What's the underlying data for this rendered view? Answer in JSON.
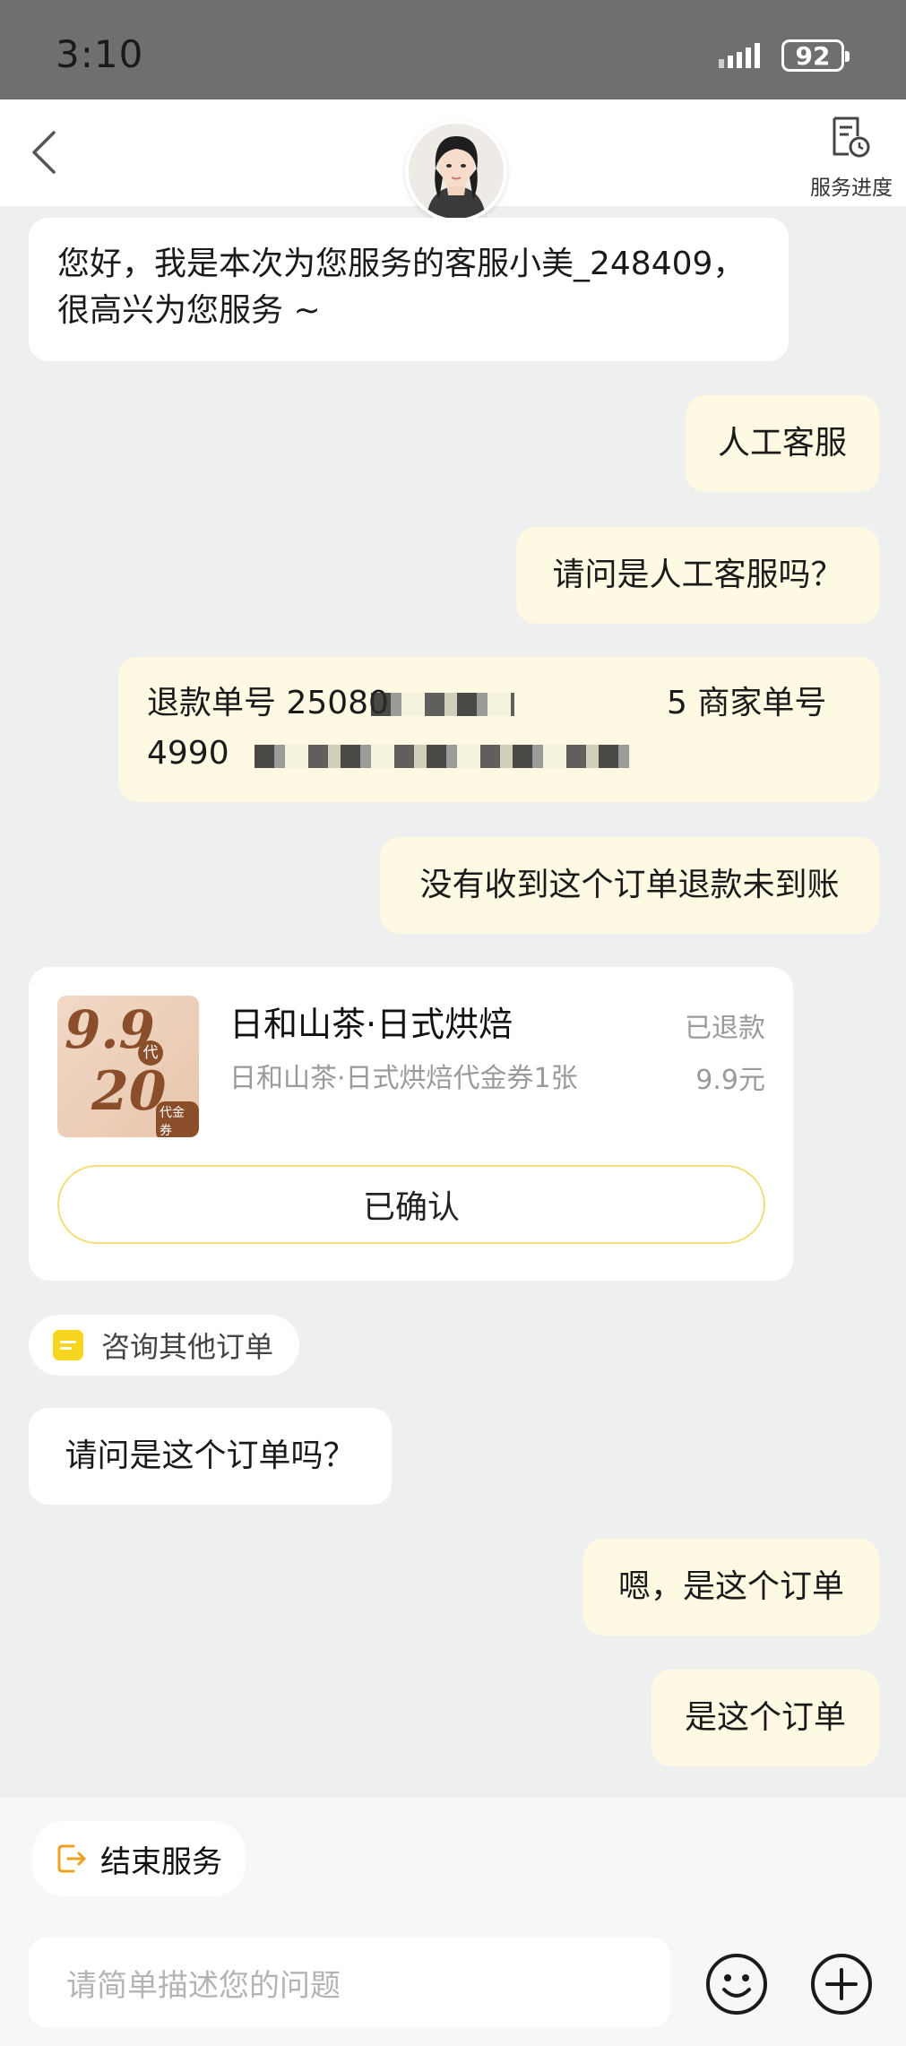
{
  "status_bar": {
    "time": "3:10",
    "battery": "92"
  },
  "header": {
    "service_progress_label": "服务进度"
  },
  "messages": [
    {
      "side": "left",
      "text": "您好，我是本次为您服务的客服小美_248409，很高兴为您服务 ~"
    },
    {
      "side": "right",
      "text": "人工客服"
    },
    {
      "side": "right",
      "text": "请问是人工客服吗？"
    },
    {
      "side": "right",
      "line1": "退款单号 25080",
      "line1_tail": "5 商家单号",
      "line2": "4990"
    },
    {
      "side": "right",
      "text": "没有收到这个订单退款未到账"
    },
    {
      "side": "left",
      "text": "请问是这个订单吗？"
    },
    {
      "side": "right",
      "text": "嗯，是这个订单"
    },
    {
      "side": "right",
      "text": "是这个订单"
    }
  ],
  "order_card": {
    "thumb": {
      "price": "9.9",
      "face_value": "20",
      "tag_dai": "代",
      "tag_voucher": "代金券"
    },
    "shop_name": "日和山茶·日式烘焙",
    "description": "日和山茶·日式烘焙代金券1张",
    "status": "已退款",
    "amount": "9.9元",
    "confirm_label": "已确认"
  },
  "quick_actions": {
    "consult_other": "咨询其他订单",
    "end_service": "结束服务"
  },
  "composer": {
    "placeholder": "请简单描述您的问题"
  },
  "colors": {
    "accent_yellow": "#f8d620",
    "user_bubble": "#fdf9e3",
    "end_icon": "#f0a020"
  }
}
